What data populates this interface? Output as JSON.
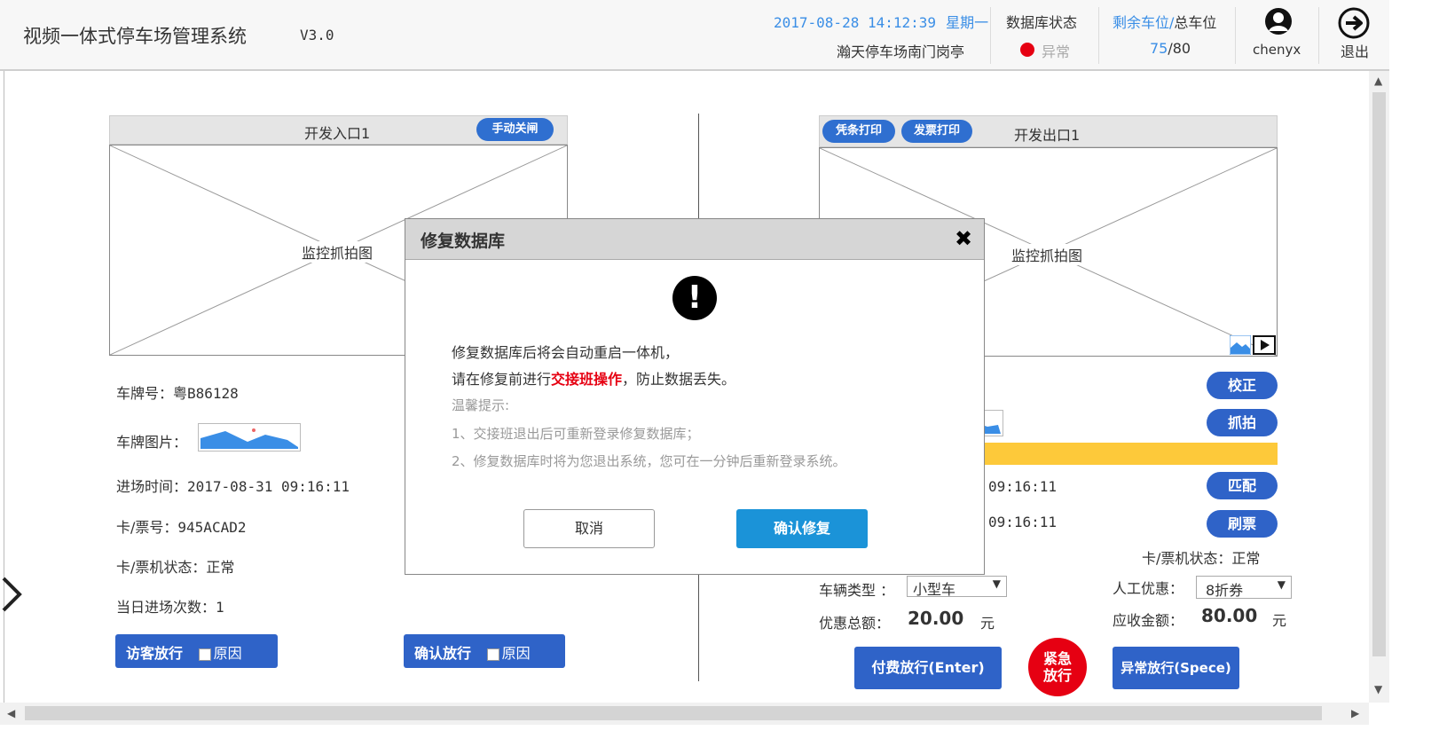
{
  "header": {
    "app_title": "视频一体式停车场管理系统",
    "version": "V3.0",
    "datetime": "2017-08-28  14:12:39",
    "weekday": "星期一",
    "location": "瀚天停车场南门岗亭",
    "db_status_label": "数据库状态",
    "db_status_value": "异常",
    "remaining_label": "剩余车位",
    "slash": "/",
    "total_label": "总车位",
    "remaining_value": "75",
    "total_value": "/80",
    "username": "chenyx",
    "logout_label": "退出"
  },
  "entry": {
    "title": "开发入口1",
    "close_gate_btn": "手动关闸",
    "cam_label": "监控抓拍图",
    "plate_label": "车牌号：",
    "plate_value": "粤B86128",
    "plate_image_label": "车牌图片：",
    "entry_time_label": "进场时间：",
    "entry_time_value": "2017-08-31 09:16:11",
    "card_label": "卡/票号：",
    "card_value": "945ACAD2",
    "machine_label": "卡/票机状态：",
    "machine_value": "正常",
    "daily_count_label": "当日进场次数：",
    "daily_count_value": "1",
    "visitor_btn": "访客放行",
    "confirm_btn": "确认放行",
    "reason_label": "原因"
  },
  "exit": {
    "title": "开发出口1",
    "voucher_print_btn": "凭条打印",
    "invoice_print_btn": "发票打印",
    "cam_label": "监控抓拍图",
    "correct_btn": "校正",
    "capture_btn": "抓拍",
    "match_btn": "匹配",
    "swipe_btn": "刷票",
    "time1": "09:16:11",
    "time2": "09:16:11",
    "machine_status": "卡/票机状态：正常",
    "vehicle_type_label": "车辆类型 ：",
    "vehicle_type_value": "小型车",
    "manual_discount_label": "人工优惠：",
    "manual_discount_value": "8折券",
    "discount_total_label": "优惠总额：",
    "discount_total_value": "20.00",
    "yuan": "元",
    "receivable_label": "应收金额：",
    "receivable_value": "80.00",
    "pay_release_btn": "付费放行(Enter)",
    "emergency_btn_line1": "紧急",
    "emergency_btn_line2": "放行",
    "abnormal_release_btn": "异常放行(Spece)"
  },
  "modal": {
    "title": "修复数据库",
    "close_icon": "✖",
    "line1": "修复数据库后将会自动重启一体机，",
    "line2_pre": "请在修复前进行",
    "line2_red": "交接班操作",
    "line2_post": "，防止数据丢失。",
    "tip_title": "温馨提示:",
    "tip1": "1、交接班退出后可重新登录修复数据库；",
    "tip2": "2、修复数据库时将为您退出系统，您可在一分钟后重新登录系统。",
    "cancel_btn": "取消",
    "confirm_btn": "确认修复"
  },
  "colors": {
    "accent_blue": "#2f63c8",
    "link_blue": "#3a8ee6",
    "danger_red": "#e60012",
    "highlight_yellow": "#fdc93a",
    "modal_confirm": "#1b93d8"
  }
}
